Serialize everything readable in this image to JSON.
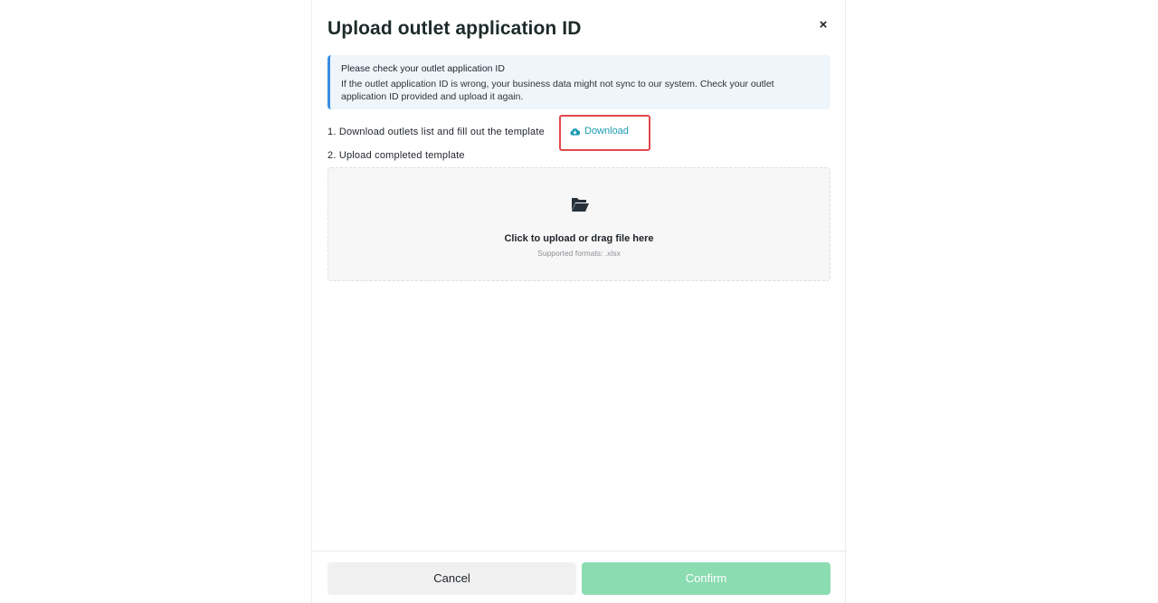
{
  "dialog": {
    "title": "Upload outlet application ID",
    "close_symbol": "×"
  },
  "notice": {
    "title": "Please check your outlet application ID",
    "body": "If the outlet application ID is wrong, your business data might not sync to our system. Check your outlet application ID provided and upload it again."
  },
  "steps": {
    "step1": "1.  Download outlets list and fill out the template",
    "download_label": "Download",
    "step2": "2.  Upload completed template"
  },
  "upload": {
    "icon": "folder-open-icon",
    "title": "Click to upload or drag file here",
    "subtitle": "Supported formats: .xlsx"
  },
  "footer": {
    "cancel_label": "Cancel",
    "confirm_label": "Confirm"
  },
  "colors": {
    "accent_link": "#1a9cb0",
    "notice_border": "#3a8ee6",
    "highlight_box": "#e4474b",
    "confirm_disabled": "#8bdcb1"
  }
}
